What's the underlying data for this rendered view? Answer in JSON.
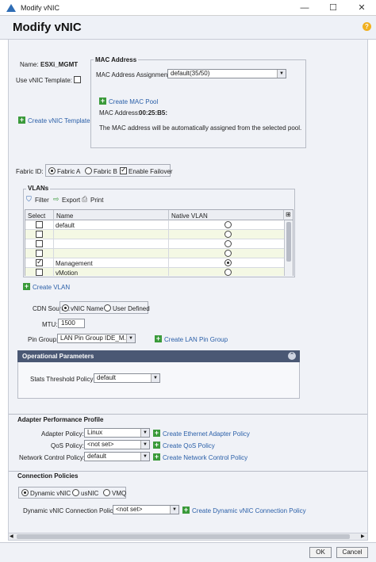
{
  "window": {
    "title": "Modify vNIC",
    "min": "—",
    "max": "☐",
    "close": "✕"
  },
  "header": {
    "title": "Modify vNIC",
    "help": "?"
  },
  "name": {
    "label": "Name:",
    "value": "ESXi_MGMT"
  },
  "template": {
    "label": "Use vNIC Template:",
    "create": "Create vNIC Template"
  },
  "mac": {
    "title": "MAC Address",
    "assign_label": "MAC Address Assignment:",
    "assign_value": "default(35/50)",
    "create_pool": "Create MAC Pool",
    "addr_label": "MAC Address:",
    "addr_value": "00:25:B5:",
    "note": "The MAC address will be automatically assigned from the selected pool."
  },
  "fabric": {
    "label": "Fabric ID:",
    "a": "Fabric A",
    "b": "Fabric B",
    "failover": "Enable Failover"
  },
  "vlans": {
    "title": "VLANs",
    "filter": "Filter",
    "export": "Export",
    "print": "Print",
    "col_select": "Select",
    "col_name": "Name",
    "col_native": "Native VLAN",
    "rows": [
      {
        "name": "default",
        "selected": false,
        "native": false
      },
      {
        "name": "",
        "selected": false,
        "native": false
      },
      {
        "name": "",
        "selected": false,
        "native": false
      },
      {
        "name": "",
        "selected": false,
        "native": false
      },
      {
        "name": "Management",
        "selected": true,
        "native": true
      },
      {
        "name": "vMotion",
        "selected": false,
        "native": false
      }
    ],
    "create": "Create VLAN"
  },
  "cdn": {
    "label": "CDN Source:",
    "opt1": "vNIC Name",
    "opt2": "User Defined"
  },
  "mtu": {
    "label": "MTU:",
    "value": "1500"
  },
  "pin": {
    "label": "Pin Group:",
    "value": "LAN Pin Group IDE_M...",
    "create": "Create LAN Pin Group"
  },
  "operational": {
    "title": "Operational Parameters",
    "stats_label": "Stats Threshold Policy:",
    "stats_value": "default"
  },
  "adapter": {
    "title": "Adapter Performance Profile",
    "adapter_label": "Adapter Policy:",
    "adapter_value": "Linux",
    "adapter_create": "Create Ethernet Adapter Policy",
    "qos_label": "QoS Policy:",
    "qos_value": "<not set>",
    "qos_create": "Create QoS Policy",
    "net_label": "Network Control Policy:",
    "net_value": "default",
    "net_create": "Create Network Control Policy"
  },
  "connection": {
    "title": "Connection Policies",
    "opt1": "Dynamic vNIC",
    "opt2": "usNIC",
    "opt3": "VMQ",
    "dyn_label": "Dynamic vNIC Connection Policy:",
    "dyn_value": "<not set>",
    "dyn_create": "Create Dynamic vNIC Connection Policy"
  },
  "footer": {
    "ok": "OK",
    "cancel": "Cancel"
  }
}
